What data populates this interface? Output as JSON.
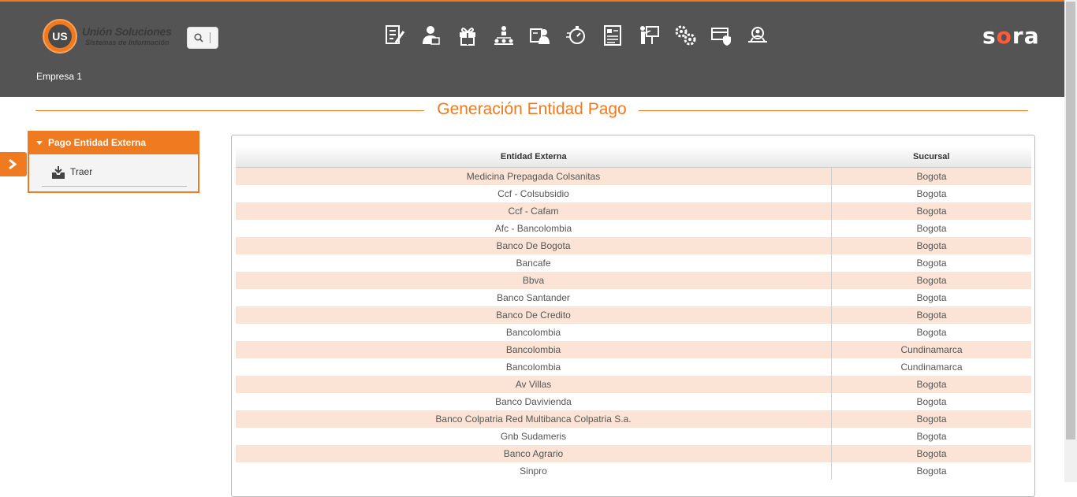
{
  "header": {
    "logo_title": "Unión Soluciones",
    "logo_subtitle": "Sistemas de Información",
    "logo_badge": "US",
    "brand_prefix": "s",
    "brand_o": "o",
    "brand_suffix": "ra",
    "company": "Empresa 1",
    "nav_icons": [
      "document-edit-icon",
      "user-profile-icon",
      "gift-icon",
      "org-chart-icon",
      "user-card-icon",
      "stopwatch-icon",
      "report-list-icon",
      "presentation-icon",
      "settings-gears-icon",
      "security-card-icon",
      "user-search-icon"
    ]
  },
  "page": {
    "title": "Generación Entidad Pago"
  },
  "sidebar": {
    "section_title": "Pago Entidad Externa",
    "items": [
      {
        "label": "Traer",
        "icon": "inbox-download-icon"
      }
    ]
  },
  "table": {
    "headers": [
      "Entidad Externa",
      "Sucursal"
    ],
    "rows": [
      [
        "Medicina Prepagada Colsanitas",
        "Bogota"
      ],
      [
        "Ccf - Colsubsidio",
        "Bogota"
      ],
      [
        "Ccf - Cafam",
        "Bogota"
      ],
      [
        "Afc - Bancolombia",
        "Bogota"
      ],
      [
        "Banco De Bogota",
        "Bogota"
      ],
      [
        "Bancafe",
        "Bogota"
      ],
      [
        "Bbva",
        "Bogota"
      ],
      [
        "Banco Santander",
        "Bogota"
      ],
      [
        "Banco De Credito",
        "Bogota"
      ],
      [
        "Bancolombia",
        "Bogota"
      ],
      [
        "Bancolombia",
        "Cundinamarca"
      ],
      [
        "Bancolombia",
        "Cundinamarca"
      ],
      [
        "Av Villas",
        "Bogota"
      ],
      [
        "Banco Davivienda",
        "Bogota"
      ],
      [
        "Banco Colpatria Red Multibanca Colpatria S.a.",
        "Bogota"
      ],
      [
        "Gnb Sudameris",
        "Bogota"
      ],
      [
        "Banco Agrario",
        "Bogota"
      ],
      [
        "Sinpro",
        "Bogota"
      ]
    ]
  },
  "colors": {
    "accent": "#f07a1f",
    "header_bg": "#545454",
    "row_alt": "#fbe4d5"
  }
}
